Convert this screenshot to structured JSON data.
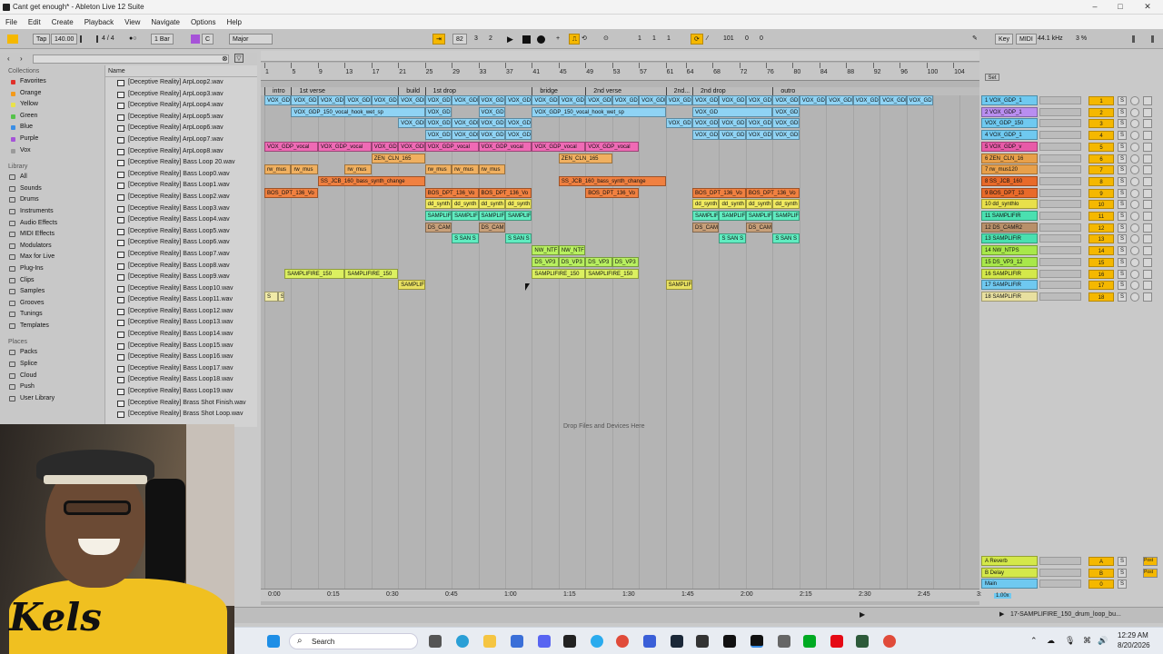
{
  "window": {
    "title": "Cant get enough* - Ableton Live 12 Suite",
    "minimize": "–",
    "maximize": "□",
    "close": "✕"
  },
  "menu": [
    "File",
    "Edit",
    "Create",
    "Playback",
    "View",
    "Navigate",
    "Options",
    "Help"
  ],
  "control": {
    "tap": "Tap",
    "tempo": "140.00",
    "time_sig": "4 / 4",
    "quant": "1 Bar",
    "key": "C",
    "scale": "Major",
    "position": [
      "82",
      "3",
      "2"
    ],
    "loop_start": [
      "1",
      "1",
      "1"
    ],
    "loop_len": [
      "101",
      "0",
      "0"
    ],
    "key_label": "Key",
    "midi_label": "MIDI",
    "sample_rate": "44.1 kHz",
    "cpu": "3 %"
  },
  "sidebar": {
    "collections_title": "Collections",
    "collections": [
      {
        "label": "Favorites",
        "color": "#e0302a"
      },
      {
        "label": "Orange",
        "color": "#f39a1c"
      },
      {
        "label": "Yellow",
        "color": "#e9e24a"
      },
      {
        "label": "Green",
        "color": "#55c24a"
      },
      {
        "label": "Blue",
        "color": "#3a8ee6"
      },
      {
        "label": "Purple",
        "color": "#a653d8"
      },
      {
        "label": "Vox",
        "color": "#9a9a9a"
      }
    ],
    "library_title": "Library",
    "library": [
      "All",
      "Sounds",
      "Drums",
      "Instruments",
      "Audio Effects",
      "MIDI Effects",
      "Modulators",
      "Max for Live",
      "Plug-Ins",
      "Clips",
      "Samples",
      "Grooves",
      "Tunings",
      "Templates"
    ],
    "places_title": "Places",
    "places": [
      "Packs",
      "Splice",
      "Cloud",
      "Push",
      "User Library"
    ]
  },
  "filelist": {
    "header": "Name",
    "items": [
      "[Deceptive Reality] ArpLoop2.wav",
      "[Deceptive Reality] ArpLoop3.wav",
      "[Deceptive Reality] ArpLoop4.wav",
      "[Deceptive Reality] ArpLoop5.wav",
      "[Deceptive Reality] ArpLoop6.wav",
      "[Deceptive Reality] ArpLoop7.wav",
      "[Deceptive Reality] ArpLoop8.wav",
      "[Deceptive Reality] Bass Loop 20.wav",
      "[Deceptive Reality] Bass Loop0.wav",
      "[Deceptive Reality] Bass Loop1.wav",
      "[Deceptive Reality] Bass Loop2.wav",
      "[Deceptive Reality] Bass Loop3.wav",
      "[Deceptive Reality] Bass Loop4.wav",
      "[Deceptive Reality] Bass Loop5.wav",
      "[Deceptive Reality] Bass Loop6.wav",
      "[Deceptive Reality] Bass Loop7.wav",
      "[Deceptive Reality] Bass Loop8.wav",
      "[Deceptive Reality] Bass Loop9.wav",
      "[Deceptive Reality] Bass Loop10.wav",
      "[Deceptive Reality] Bass Loop11.wav",
      "[Deceptive Reality] Bass Loop12.wav",
      "[Deceptive Reality] Bass Loop13.wav",
      "[Deceptive Reality] Bass Loop14.wav",
      "[Deceptive Reality] Bass Loop15.wav",
      "[Deceptive Reality] Bass Loop16.wav",
      "[Deceptive Reality] Bass Loop17.wav",
      "[Deceptive Reality] Bass Loop18.wav",
      "[Deceptive Reality] Bass Loop19.wav",
      "[Deceptive Reality] Brass Shot Finish.wav",
      "[Deceptive Reality] Brass Shot Loop.wav"
    ]
  },
  "ruler": [
    "1",
    "5",
    "9",
    "13",
    "17",
    "21",
    "25",
    "29",
    "33",
    "37",
    "41",
    "45",
    "49",
    "53",
    "57",
    "61",
    "64",
    "68",
    "72",
    "76",
    "80",
    "84",
    "88",
    "92",
    "96",
    "100",
    "104"
  ],
  "locators": [
    "intro",
    "1st verse",
    "build",
    "1st drop",
    "bridge",
    "2nd verse",
    "2nd...",
    "2nd drop",
    "outro"
  ],
  "drop_text": "Drop Files and Devices Here",
  "time_axis": [
    "0:00",
    "0:15",
    "0:30",
    "0:45",
    "1:00",
    "1:15",
    "1:30",
    "1:45",
    "2:00",
    "2:15",
    "2:30",
    "2:45",
    "3:00"
  ],
  "tracks": [
    {
      "name": "1 VOX_GDP_1",
      "color": "#6fc9f0",
      "num": "1"
    },
    {
      "name": "2 VOX_GDP_1",
      "color": "#b98ef0",
      "num": "2"
    },
    {
      "name": "VOX_GDP_150",
      "color": "#6fc9f0",
      "num": "3"
    },
    {
      "name": "4 VOX_GDP_1",
      "color": "#6fc9f0",
      "num": "4"
    },
    {
      "name": "5 VOX_GDP_v",
      "color": "#e85aa8",
      "num": "5"
    },
    {
      "name": "6 ZEN_CLN_16",
      "color": "#e8a04a",
      "num": "6"
    },
    {
      "name": "7 rw_mus120",
      "color": "#e8a04a",
      "num": "7"
    },
    {
      "name": "8 SS_JCB_160",
      "color": "#e86a2a",
      "num": "8"
    },
    {
      "name": "9 BOS_DPT_13",
      "color": "#e86a2a",
      "num": "9"
    },
    {
      "name": "10 dd_synthlo",
      "color": "#e8e04a",
      "num": "10"
    },
    {
      "name": "11 SAMPLIFIR",
      "color": "#4ae0b0",
      "num": "11"
    },
    {
      "name": "12 DS_CAMR2",
      "color": "#b8906a",
      "num": "12"
    },
    {
      "name": "13 SAMPLIFIR",
      "color": "#4ae0b0",
      "num": "13"
    },
    {
      "name": "14 NW_NTPS",
      "color": "#a8e84a",
      "num": "14"
    },
    {
      "name": "15 DS_VP3_12",
      "color": "#a8e84a",
      "num": "15"
    },
    {
      "name": "16 SAMPLIFIR",
      "color": "#d4e84a",
      "num": "16"
    },
    {
      "name": "17 SAMPLIFIR",
      "color": "#6fc9f0",
      "num": "17"
    },
    {
      "name": "18 SAMPLIFIR",
      "color": "#e8e0a0",
      "num": "18"
    }
  ],
  "returns": [
    {
      "name": "A Reverb",
      "num": "A",
      "post": "Post"
    },
    {
      "name": "B Delay",
      "num": "B",
      "post": "Post"
    },
    {
      "name": "Main",
      "num": "0",
      "post": ""
    }
  ],
  "clips": [
    {
      "row": 0,
      "bars": [
        [
          1,
          5
        ],
        [
          5,
          9
        ],
        [
          9,
          13
        ],
        [
          13,
          17
        ],
        [
          17,
          21
        ],
        [
          21,
          25
        ],
        [
          25,
          29
        ],
        [
          29,
          33
        ],
        [
          33,
          37
        ],
        [
          37,
          41
        ],
        [
          41,
          45
        ],
        [
          45,
          49
        ],
        [
          49,
          53
        ],
        [
          53,
          57
        ],
        [
          57,
          61
        ],
        [
          61,
          65
        ],
        [
          65,
          69
        ],
        [
          69,
          73
        ],
        [
          73,
          77
        ],
        [
          77,
          81
        ],
        [
          81,
          85
        ],
        [
          85,
          89
        ],
        [
          89,
          93
        ],
        [
          93,
          97
        ],
        [
          97,
          101
        ]
      ],
      "label": "VOX_GDP",
      "color": "#8fd3f4"
    },
    {
      "row": 1,
      "bars": [
        [
          5,
          25
        ]
      ],
      "label": "VOX_GDP_150_vocal_hook_wet_sp",
      "color": "#8fd3f4"
    },
    {
      "row": 1,
      "bars": [
        [
          25,
          29
        ],
        [
          33,
          37
        ]
      ],
      "label": "VOX_GD",
      "color": "#8fd3f4"
    },
    {
      "row": 1,
      "bars": [
        [
          41,
          61
        ]
      ],
      "label": "VOX_GDP_150_vocal_hook_wet_sp",
      "color": "#8fd3f4"
    },
    {
      "row": 1,
      "bars": [
        [
          65,
          77
        ],
        [
          77,
          81
        ]
      ],
      "label": "VOX_GD",
      "color": "#8fd3f4"
    },
    {
      "row": 2,
      "bars": [
        [
          21,
          25
        ],
        [
          25,
          29
        ],
        [
          29,
          33
        ],
        [
          33,
          37
        ],
        [
          37,
          41
        ],
        [
          61,
          65
        ],
        [
          65,
          69
        ],
        [
          69,
          73
        ],
        [
          73,
          77
        ],
        [
          77,
          81
        ]
      ],
      "label": "VOX_GDP_150_vo",
      "color": "#8fd3f4"
    },
    {
      "row": 3,
      "bars": [
        [
          25,
          29
        ],
        [
          29,
          33
        ],
        [
          33,
          37
        ],
        [
          37,
          41
        ],
        [
          65,
          69
        ],
        [
          69,
          73
        ],
        [
          73,
          77
        ],
        [
          77,
          81
        ]
      ],
      "label": "VOX_GDP_150_vo",
      "color": "#8fd3f4"
    },
    {
      "row": 4,
      "bars": [
        [
          1,
          9
        ],
        [
          9,
          17
        ],
        [
          17,
          21
        ],
        [
          21,
          25
        ],
        [
          25,
          33
        ],
        [
          33,
          41
        ],
        [
          41,
          49
        ],
        [
          49,
          57
        ]
      ],
      "label": "VOX_GDP_vocal",
      "color": "#ef6ab5"
    },
    {
      "row": 5,
      "bars": [
        [
          17,
          25
        ],
        [
          45,
          53
        ]
      ],
      "label": "ZEN_CLN_165",
      "color": "#f0b060"
    },
    {
      "row": 6,
      "bars": [
        [
          1,
          5
        ],
        [
          5,
          9
        ],
        [
          13,
          17
        ],
        [
          25,
          29
        ],
        [
          29,
          33
        ],
        [
          33,
          37
        ]
      ],
      "label": "rw_mus",
      "color": "#f0b060"
    },
    {
      "row": 7,
      "bars": [
        [
          9,
          25
        ],
        [
          45,
          61
        ]
      ],
      "label": "SS_JCB_160_bass_synth_change",
      "color": "#f08040"
    },
    {
      "row": 8,
      "bars": [
        [
          1,
          9
        ],
        [
          25,
          33
        ],
        [
          33,
          41
        ],
        [
          49,
          57
        ],
        [
          65,
          73
        ],
        [
          73,
          81
        ]
      ],
      "label": "BOS_DPT_136_Vo",
      "color": "#f08040"
    },
    {
      "row": 9,
      "bars": [
        [
          25,
          29
        ],
        [
          29,
          33
        ],
        [
          33,
          37
        ],
        [
          37,
          41
        ],
        [
          65,
          69
        ],
        [
          69,
          73
        ],
        [
          73,
          77
        ],
        [
          77,
          81
        ]
      ],
      "label": "dd_synth",
      "color": "#f0ea60"
    },
    {
      "row": 10,
      "bars": [
        [
          25,
          29
        ],
        [
          29,
          33
        ],
        [
          33,
          37
        ],
        [
          37,
          41
        ],
        [
          65,
          69
        ],
        [
          69,
          73
        ],
        [
          73,
          77
        ],
        [
          77,
          81
        ]
      ],
      "label": "SAMPLIFI",
      "color": "#60ecc0"
    },
    {
      "row": 11,
      "bars": [
        [
          25,
          29
        ],
        [
          33,
          37
        ],
        [
          65,
          69
        ],
        [
          73,
          77
        ]
      ],
      "label": "DS_CAM",
      "color": "#c8a07a"
    },
    {
      "row": 12,
      "bars": [
        [
          29,
          33
        ],
        [
          37,
          41
        ],
        [
          69,
          73
        ],
        [
          77,
          81
        ]
      ],
      "label": "S SAN S",
      "color": "#60ecc0"
    },
    {
      "row": 13,
      "bars": [
        [
          41,
          45
        ],
        [
          45,
          49
        ]
      ],
      "label": "NW_NTF",
      "color": "#b8f060"
    },
    {
      "row": 14,
      "bars": [
        [
          41,
          45
        ],
        [
          45,
          49
        ],
        [
          49,
          53
        ],
        [
          53,
          57
        ]
      ],
      "label": "DS_VP3",
      "color": "#b8f060"
    },
    {
      "row": 15,
      "bars": [
        [
          4,
          13
        ],
        [
          13,
          21
        ],
        [
          41,
          49
        ],
        [
          49,
          57
        ]
      ],
      "label": "SAMPLIFIRE_150",
      "color": "#dcf060"
    },
    {
      "row": 16,
      "bars": [
        [
          21,
          25
        ],
        [
          61,
          65
        ]
      ],
      "label": "SAMPLIF",
      "color": "#e8e060"
    },
    {
      "row": 17,
      "bars": [
        [
          1,
          3
        ],
        [
          3,
          4
        ]
      ],
      "label": "S",
      "color": "#f0eaa8"
    }
  ],
  "status": {
    "clip_name": "17-SAMPLIFIRE_150_drum_loop_bu...",
    "zoom": "1.00x"
  },
  "taskbar": {
    "search": "Search",
    "time": "12:29 AM",
    "date": "8/20/2026"
  },
  "webcam": {
    "logo": "Kels"
  }
}
